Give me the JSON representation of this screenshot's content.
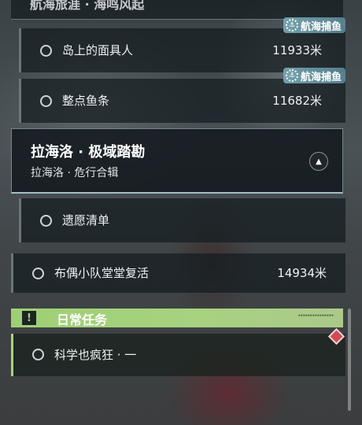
{
  "top_header": {
    "title": "航海旅涯 · 海鸣风起"
  },
  "quests_a": [
    {
      "name": "岛上的面具人",
      "distance": "11933米",
      "tag": "航海捕鱼",
      "tag_icon": "sailing-gear-icon"
    },
    {
      "name": "整点鱼条",
      "distance": "11682米",
      "tag": "航海捕鱼",
      "tag_icon": "sailing-gear-icon"
    }
  ],
  "chapter": {
    "title": "拉海洛 · 极域踏勘",
    "subtitle": "拉海洛 · 危行合辑",
    "collapse_icon": "chevron-up-icon"
  },
  "quests_b": [
    {
      "name": "遗愿清单",
      "distance": ""
    },
    {
      "name": "布偶小队堂堂复活",
      "distance": "14934米"
    }
  ],
  "daily": {
    "label": "日常任务",
    "icon": "exclamation-icon",
    "icon_glyph": "!",
    "deco": "▪▪▪▪▪▪▪▪▪▪▪▪▪▪▪"
  },
  "daily_quests": [
    {
      "name": "科学也疯狂 · 一",
      "marker": "red-diamond-icon"
    }
  ],
  "colors": {
    "daily_accent": "#a7d280",
    "tag_bg": "#78a5af",
    "marker": "#d14a55"
  }
}
